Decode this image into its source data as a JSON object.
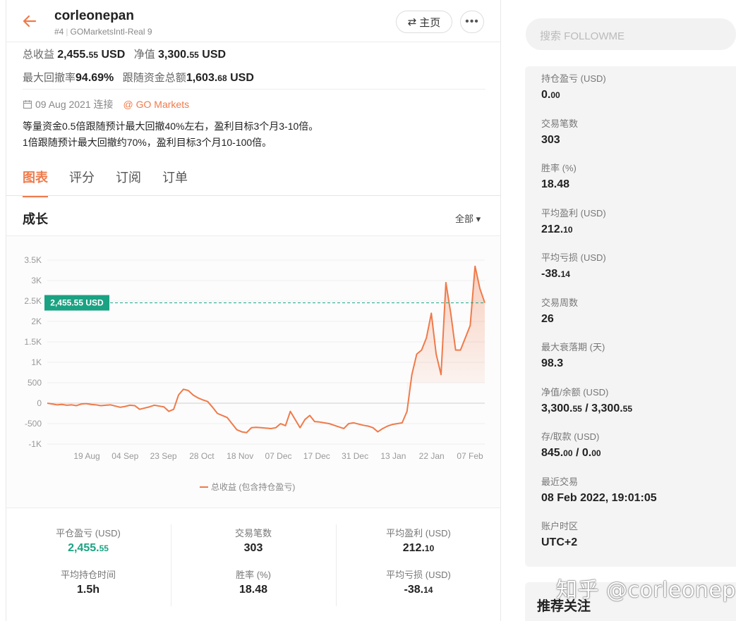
{
  "header": {
    "username": "corleonepan",
    "rank": "#4",
    "account": "GOMarketsIntl-Real 9",
    "home_label": "主页",
    "more_label": "•••"
  },
  "summary": {
    "total_profit_label": "总收益",
    "total_profit_value": "2,455.",
    "total_profit_dec": "55",
    "total_profit_unit": "USD",
    "equity_label": "净值",
    "equity_value": "3,300.",
    "equity_dec": "55",
    "equity_unit": "USD",
    "max_dd_label": "最大回撤率",
    "max_dd_value": "94.69%",
    "follow_funds_label": "跟随资金总额",
    "follow_funds_value": "1,603.",
    "follow_funds_dec": "68",
    "follow_funds_unit": "USD"
  },
  "connection": {
    "date": "09 Aug 2021 连接",
    "broker": "@ GO Markets"
  },
  "description": [
    "等量资金0.5倍跟随预计最大回撤40%左右，盈利目标3个月3-10倍。",
    "1倍跟随预计最大回撤约70%，盈利目标3个月10-100倍。"
  ],
  "tabs": [
    {
      "label": "图表",
      "active": true
    },
    {
      "label": "评分",
      "active": false
    },
    {
      "label": "订阅",
      "active": false
    },
    {
      "label": "订单",
      "active": false
    }
  ],
  "growth": {
    "title": "成长",
    "filter": "全部 ▾",
    "legend": "总收益 (包含持仓盈亏)"
  },
  "chart_data": {
    "type": "area",
    "yticks": [
      "3.5K",
      "3K",
      "2.5K",
      "2K",
      "1.5K",
      "1K",
      "500",
      "0",
      "-500",
      "-1K"
    ],
    "xticks": [
      "19 Aug",
      "04 Sep",
      "23 Sep",
      "28 Oct",
      "18 Nov",
      "07 Dec",
      "17 Dec",
      "31 Dec",
      "13 Jan",
      "22 Jan",
      "07 Feb"
    ],
    "ylim": [
      -1000,
      3500
    ],
    "current_label": "2,455.55 USD",
    "current_value": 2455.55,
    "series": [
      {
        "name": "总收益 (包含持仓盈亏)",
        "color": "#f07a4a",
        "values": [
          0,
          -20,
          -40,
          -30,
          -50,
          -40,
          -60,
          -20,
          -10,
          -30,
          -40,
          -60,
          -50,
          -40,
          -70,
          -100,
          -80,
          -50,
          -60,
          -150,
          -120,
          -90,
          -50,
          -70,
          -90,
          -200,
          -150,
          200,
          340,
          310,
          200,
          130,
          80,
          40,
          -100,
          -250,
          -300,
          -350,
          -500,
          -650,
          -700,
          -720,
          -600,
          -590,
          -600,
          -610,
          -620,
          -600,
          -500,
          -550,
          -200,
          -400,
          -600,
          -400,
          -300,
          -450,
          -460,
          -480,
          -500,
          -540,
          -580,
          -620,
          -500,
          -480,
          -510,
          -540,
          -560,
          -600,
          -700,
          -620,
          -560,
          -520,
          -500,
          -480,
          -200,
          700,
          1200,
          1300,
          1600,
          2200,
          1200,
          700,
          2950,
          2200,
          1300,
          1300,
          1600,
          1900,
          3350,
          2800,
          2455.55
        ]
      }
    ]
  },
  "bottom_stats": [
    {
      "label": "平仓盈亏 (USD)",
      "value": "2,455.",
      "dec": "55",
      "green": true
    },
    {
      "label": "交易笔数",
      "value": "303",
      "dec": "",
      "green": false
    },
    {
      "label": "平均盈利 (USD)",
      "value": "212.",
      "dec": "10",
      "green": false
    },
    {
      "label": "平均持仓时间",
      "value": "1.5h",
      "dec": "",
      "green": false
    },
    {
      "label": "胜率 (%)",
      "value": "18.48",
      "dec": "",
      "green": false
    },
    {
      "label": "平均亏损 (USD)",
      "value": "-38.",
      "dec": "14",
      "green": false
    }
  ],
  "right": {
    "search_placeholder": "搜索 FOLLOWME",
    "stats": [
      {
        "label": "持仓盈亏 (USD)",
        "value": "0.",
        "dec": "00"
      },
      {
        "label": "交易笔数",
        "value": "303",
        "dec": ""
      },
      {
        "label": "胜率 (%)",
        "value": "18.48",
        "dec": ""
      },
      {
        "label": "平均盈利 (USD)",
        "value": "212.",
        "dec": "10"
      },
      {
        "label": "平均亏损 (USD)",
        "value": "-38.",
        "dec": "14"
      },
      {
        "label": "交易周数",
        "value": "26",
        "dec": ""
      },
      {
        "label": "最大衰落期 (天)",
        "value": "98.3",
        "dec": ""
      },
      {
        "label": "净值/余额 (USD)",
        "value": "3,300.",
        "dec": "55",
        "value2": " / 3,300.",
        "dec2": "55"
      },
      {
        "label": "存/取款 (USD)",
        "value": "845.",
        "dec": "00",
        "value2": " / 0.",
        "dec2": "00"
      },
      {
        "label": "最近交易",
        "value": "08 Feb 2022, 19:01:05",
        "dec": ""
      },
      {
        "label": "账户时区",
        "value": "UTC+2",
        "dec": ""
      }
    ],
    "recommend_title": "推荐关注",
    "watermark": "知乎 @corleonepan"
  }
}
